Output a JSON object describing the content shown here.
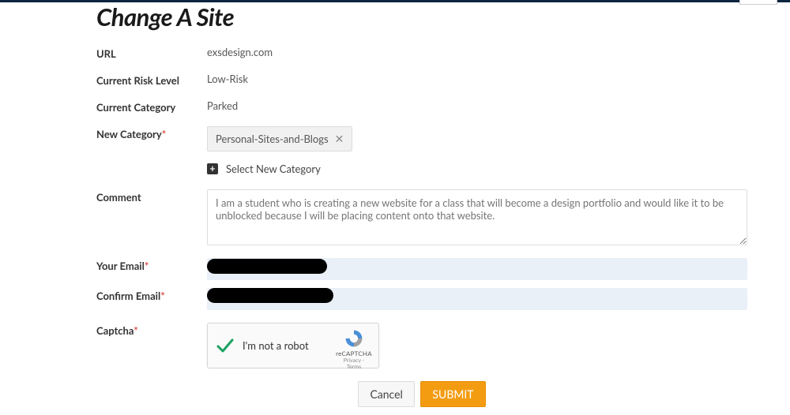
{
  "title": "Change A Site",
  "labels": {
    "url": "URL",
    "risk": "Current Risk Level",
    "category": "Current Category",
    "newCategory": "New Category",
    "comment": "Comment",
    "email": "Your Email",
    "confirmEmail": "Confirm Email",
    "captcha": "Captcha"
  },
  "values": {
    "url": "exsdesign.com",
    "risk": "Low-Risk",
    "category": "Parked",
    "newCategoryTag": "Personal-Sites-and-Blogs",
    "selectNew": "Select New Category",
    "comment": "I am a student who is creating a new website for a class that will become a design portfolio and would like it to be unblocked because I will be placing content onto that website."
  },
  "captcha": {
    "label": "I'm not a robot",
    "brand": "reCAPTCHA",
    "links": "Privacy - Terms"
  },
  "buttons": {
    "cancel": "Cancel",
    "submit": "SUBMIT"
  }
}
